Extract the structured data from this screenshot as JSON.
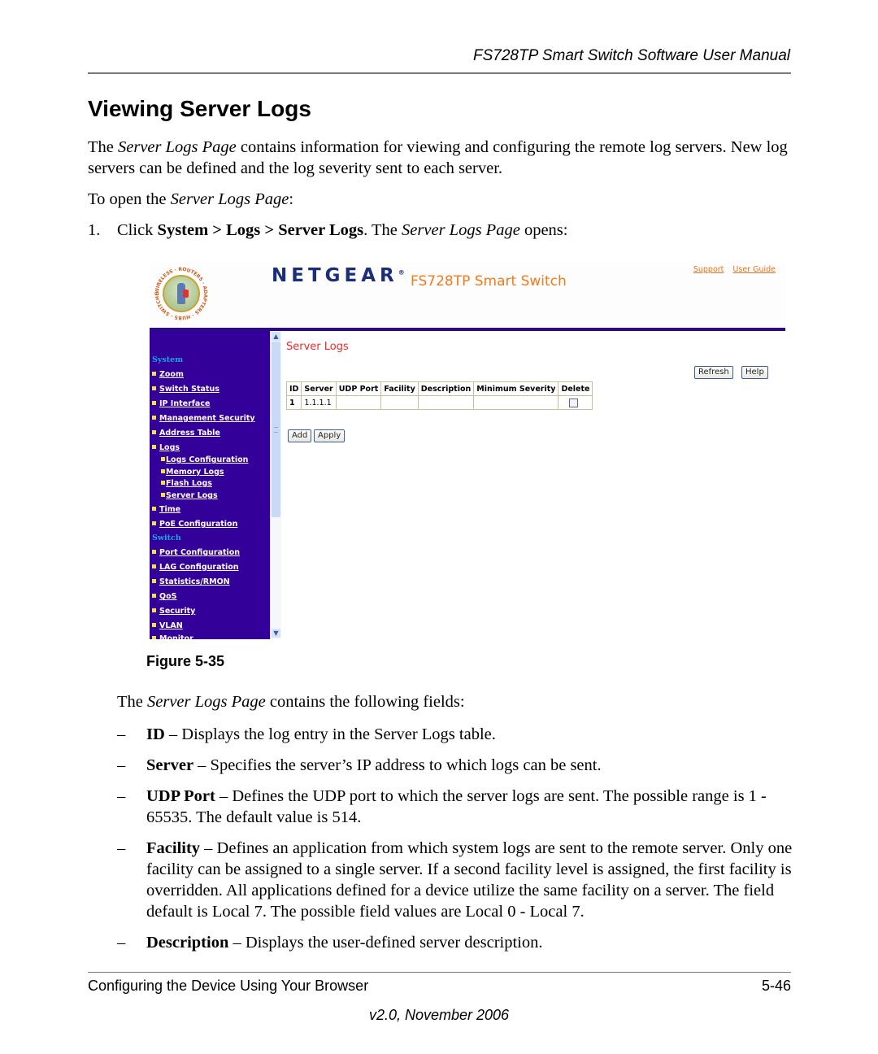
{
  "running_header": "FS728TP Smart Switch Software User Manual",
  "section_title": "Viewing Server Logs",
  "intro": {
    "p1_a": "The ",
    "p1_em": "Server Logs Page",
    "p1_b": " contains information for viewing and configuring the remote log servers. New log servers can be defined and the log severity sent to each server.",
    "p2_a": "To open the ",
    "p2_em": "Server Logs Page",
    "p2_b": ":"
  },
  "step": {
    "number": "1.",
    "a": "Click ",
    "path": "System > Logs > Server Logs",
    "b": ". The ",
    "em": "Server Logs Page",
    "c": " opens:"
  },
  "screenshot": {
    "logo_ring_text": "WIRELESS · ROUTERS · ADAPTERS · HUBS · SWITCHES",
    "brand": "NETGEAR",
    "brand_mark": "®",
    "product": "FS728TP Smart Switch",
    "links": [
      "Support",
      "User Guide"
    ],
    "sidebar": {
      "groups": [
        {
          "label": "System"
        },
        {
          "label": "Switch"
        }
      ],
      "items": [
        {
          "label": "Zoom"
        },
        {
          "label": "Switch Status"
        },
        {
          "label": "IP Interface"
        },
        {
          "label": "Management Security"
        },
        {
          "label": "Address Table"
        },
        {
          "label": "Logs"
        },
        {
          "label": "Logs Configuration"
        },
        {
          "label": "Memory Logs"
        },
        {
          "label": "Flash Logs"
        },
        {
          "label": "Server Logs"
        },
        {
          "label": "Time"
        },
        {
          "label": "PoE Configuration"
        },
        {
          "label": "Port Configuration"
        },
        {
          "label": "LAG Configuration"
        },
        {
          "label": "Statistics/RMON"
        },
        {
          "label": "QoS"
        },
        {
          "label": "Security"
        },
        {
          "label": "VLAN"
        },
        {
          "label": "Monitor"
        }
      ]
    },
    "scroll_up": "▲",
    "scroll_down": "▼",
    "page_title": "Server Logs",
    "buttons": {
      "refresh": "Refresh",
      "help": "Help",
      "add": "Add",
      "apply": "Apply"
    },
    "table": {
      "columns": [
        "ID",
        "Server",
        "UDP Port",
        "Facility",
        "Description",
        "Minimum Severity",
        "Delete"
      ],
      "rows": [
        {
          "id": "1",
          "server": "1.1.1.1",
          "udp_port": "",
          "facility": "",
          "description": "",
          "min_severity": "",
          "delete_checked": false
        }
      ]
    }
  },
  "figure_caption": "Figure 5-35",
  "fields_intro": {
    "a": "The ",
    "em": "Server Logs Page",
    "b": " contains the following fields:"
  },
  "fields": [
    {
      "term": "ID",
      "desc": " – Displays the log entry in the Server Logs table."
    },
    {
      "term": "Server",
      "desc": " – Specifies the server’s IP address to which logs can be sent."
    },
    {
      "term": "UDP Port",
      "desc": " – Defines the UDP port to which the server logs are sent. The possible range is 1 - 65535. The default value is 514."
    },
    {
      "term": "Facility",
      "desc": " – Defines an application from which system logs are sent to the remote server. Only one facility can be assigned to a single server. If a second facility level is assigned, the first facility is overridden. All applications defined for a device utilize the same facility on a server. The field default is Local 7. The possible field values are Local 0 - Local 7."
    },
    {
      "term": "Description",
      "desc": " – Displays the user-defined server description."
    }
  ],
  "dash": "–",
  "footer": {
    "left": "Configuring the Device Using Your Browser",
    "right": "5-46",
    "version": "v2.0, November 2006"
  }
}
